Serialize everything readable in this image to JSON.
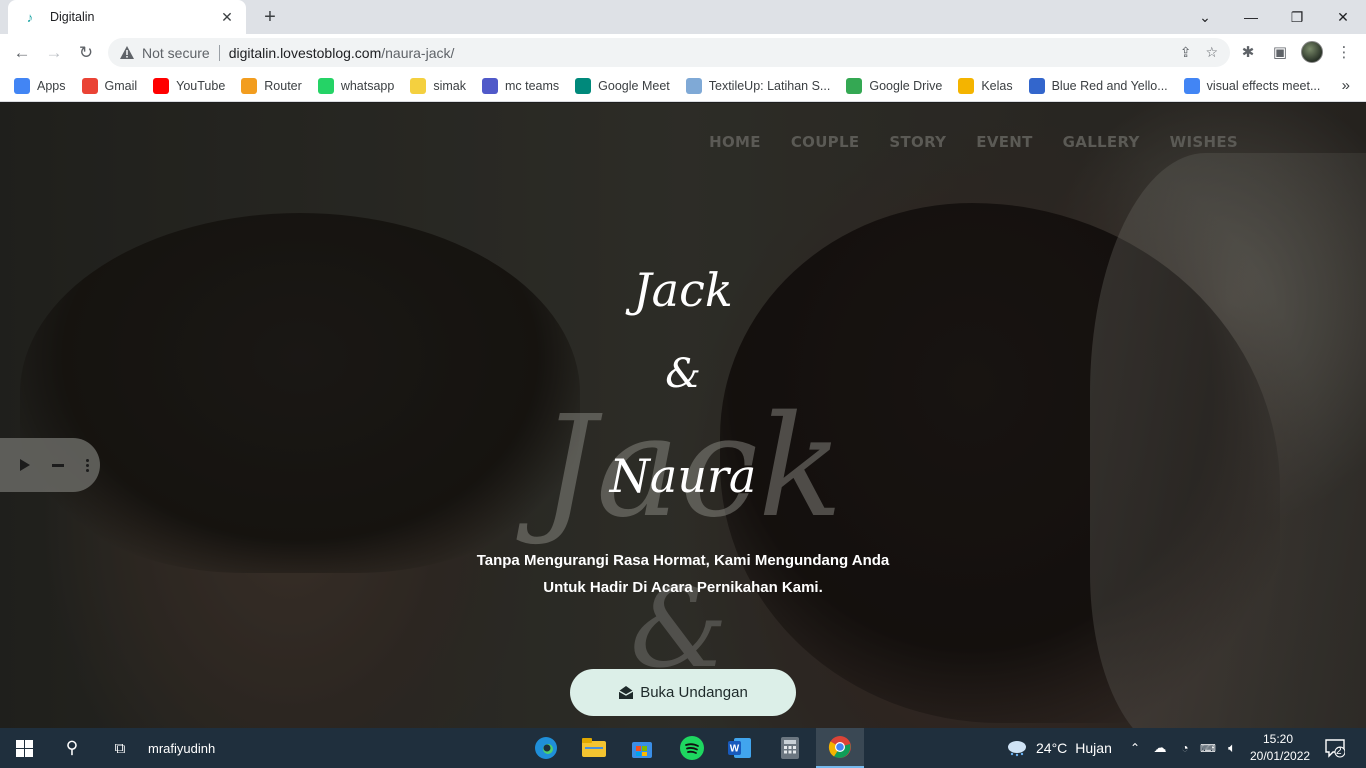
{
  "browser": {
    "tab_title": "Digitalin",
    "url_security": "Not secure",
    "url_host": "digitalin.lovestoblog.com",
    "url_path": "/naura-jack/",
    "bookmarks": [
      {
        "label": "Apps",
        "icon": "apps-grid-icon",
        "color": "#4285f4"
      },
      {
        "label": "Gmail",
        "icon": "gmail-icon",
        "color": "#ea4335"
      },
      {
        "label": "YouTube",
        "icon": "youtube-icon",
        "color": "#ff0000"
      },
      {
        "label": "Router",
        "icon": "router-icon",
        "color": "#f29d1f"
      },
      {
        "label": "whatsapp",
        "icon": "whatsapp-icon",
        "color": "#25d366"
      },
      {
        "label": "simak",
        "icon": "simak-icon",
        "color": "#f4d03f"
      },
      {
        "label": "mc teams",
        "icon": "teams-icon",
        "color": "#5059c9"
      },
      {
        "label": "Google Meet",
        "icon": "google-meet-icon",
        "color": "#00897b"
      },
      {
        "label": "TextileUp: Latihan S...",
        "icon": "textileup-icon",
        "color": "#7fa9d6"
      },
      {
        "label": "Google Drive",
        "icon": "google-drive-icon",
        "color": "#34a853"
      },
      {
        "label": "Kelas",
        "icon": "classroom-icon",
        "color": "#f4b400"
      },
      {
        "label": "Blue Red and Yello...",
        "icon": "canva-icon",
        "color": "#3366cc"
      },
      {
        "label": "visual effects meet...",
        "icon": "google-icon",
        "color": "#4285f4"
      }
    ]
  },
  "site": {
    "nav": [
      "HOME",
      "COUPLE",
      "STORY",
      "EVENT",
      "GALLERY",
      "WISHES"
    ],
    "groom": "Jack",
    "ampersand": "&",
    "bride": "Naura",
    "ghost_name": "Jack",
    "ghost_amp": "&",
    "invite_line1": "Tanpa Mengurangi Rasa Hormat, Kami Mengundang Anda",
    "invite_line2": "Untuk Hadir Di Acara Pernikahan Kami.",
    "cta_label": "Buka Undangan"
  },
  "taskbar": {
    "user": "mrafiyudinh",
    "weather_temp": "24°C",
    "weather_desc": "Hujan",
    "time": "15:20",
    "date": "20/01/2022",
    "notif_count": "2"
  }
}
